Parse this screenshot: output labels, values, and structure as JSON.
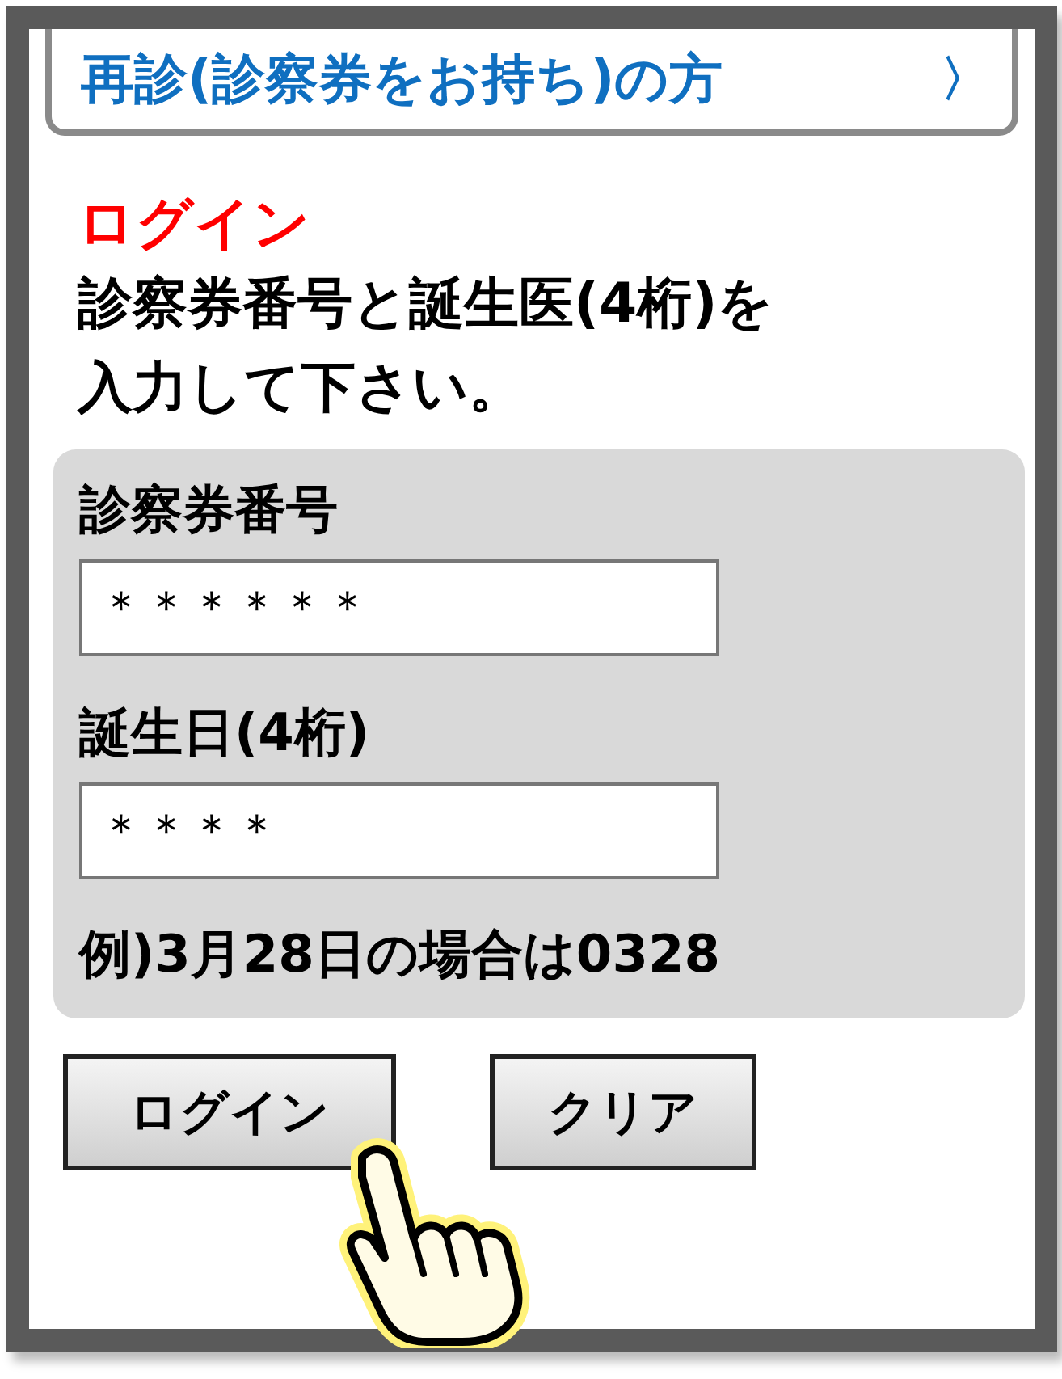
{
  "header": {
    "title": "再診(診察券をお持ち)の方",
    "chevron": "〉"
  },
  "login_heading": "ログイン",
  "instruction_lines": [
    "診察券番号と誕生医(4桁)を",
    "入力して下さい。"
  ],
  "form": {
    "fields": [
      {
        "label": "診察券番号",
        "value": "＊＊＊＊＊＊"
      },
      {
        "label": "誕生日(4桁)",
        "value": "＊＊＊＊"
      }
    ],
    "example": "例)3月28日の場合は0328"
  },
  "buttons": [
    {
      "label": "ログイン"
    },
    {
      "label": "クリア"
    }
  ]
}
